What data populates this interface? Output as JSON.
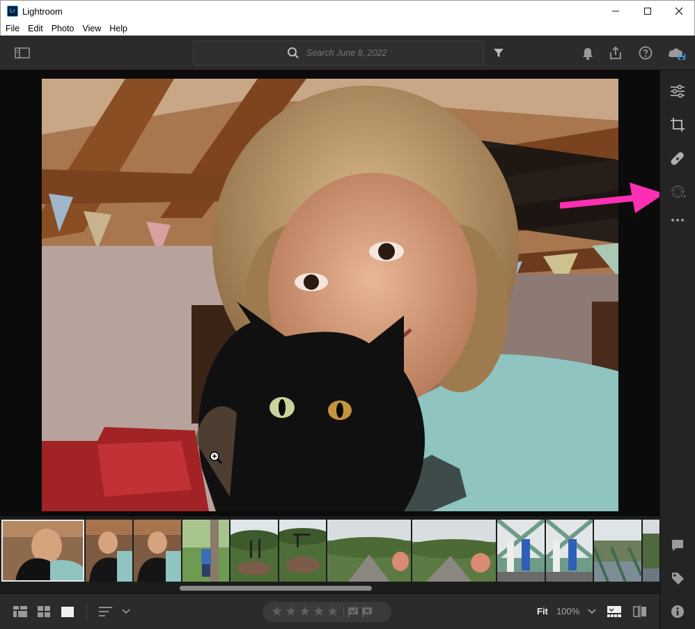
{
  "window": {
    "title": "Lightroom",
    "logo_text": "Lr",
    "minimize_icon": "minimize-icon",
    "maximize_icon": "maximize-icon",
    "close_icon": "close-icon"
  },
  "menu": {
    "items": [
      "File",
      "Edit",
      "Photo",
      "View",
      "Help"
    ]
  },
  "toolbar": {
    "search_placeholder": "Search June 8, 2022",
    "icons": [
      "panel-toggle-icon",
      "search-icon",
      "filter-icon",
      "bell-icon",
      "share-icon",
      "help-icon",
      "cloud-sync-icon"
    ]
  },
  "right_panel": {
    "icons": [
      "edit-sliders-icon",
      "crop-icon",
      "healing-icon",
      "masking-icon",
      "more-icon",
      "comment-icon",
      "tag-icon",
      "info-icon"
    ]
  },
  "bottom": {
    "fit_label": "Fit",
    "zoom_label": "100%",
    "stars": [
      "★",
      "★",
      "★",
      "★",
      "★"
    ]
  },
  "colors": {
    "accent_arrow": "#ff2fb3",
    "accent_blue": "#31a8ff"
  }
}
